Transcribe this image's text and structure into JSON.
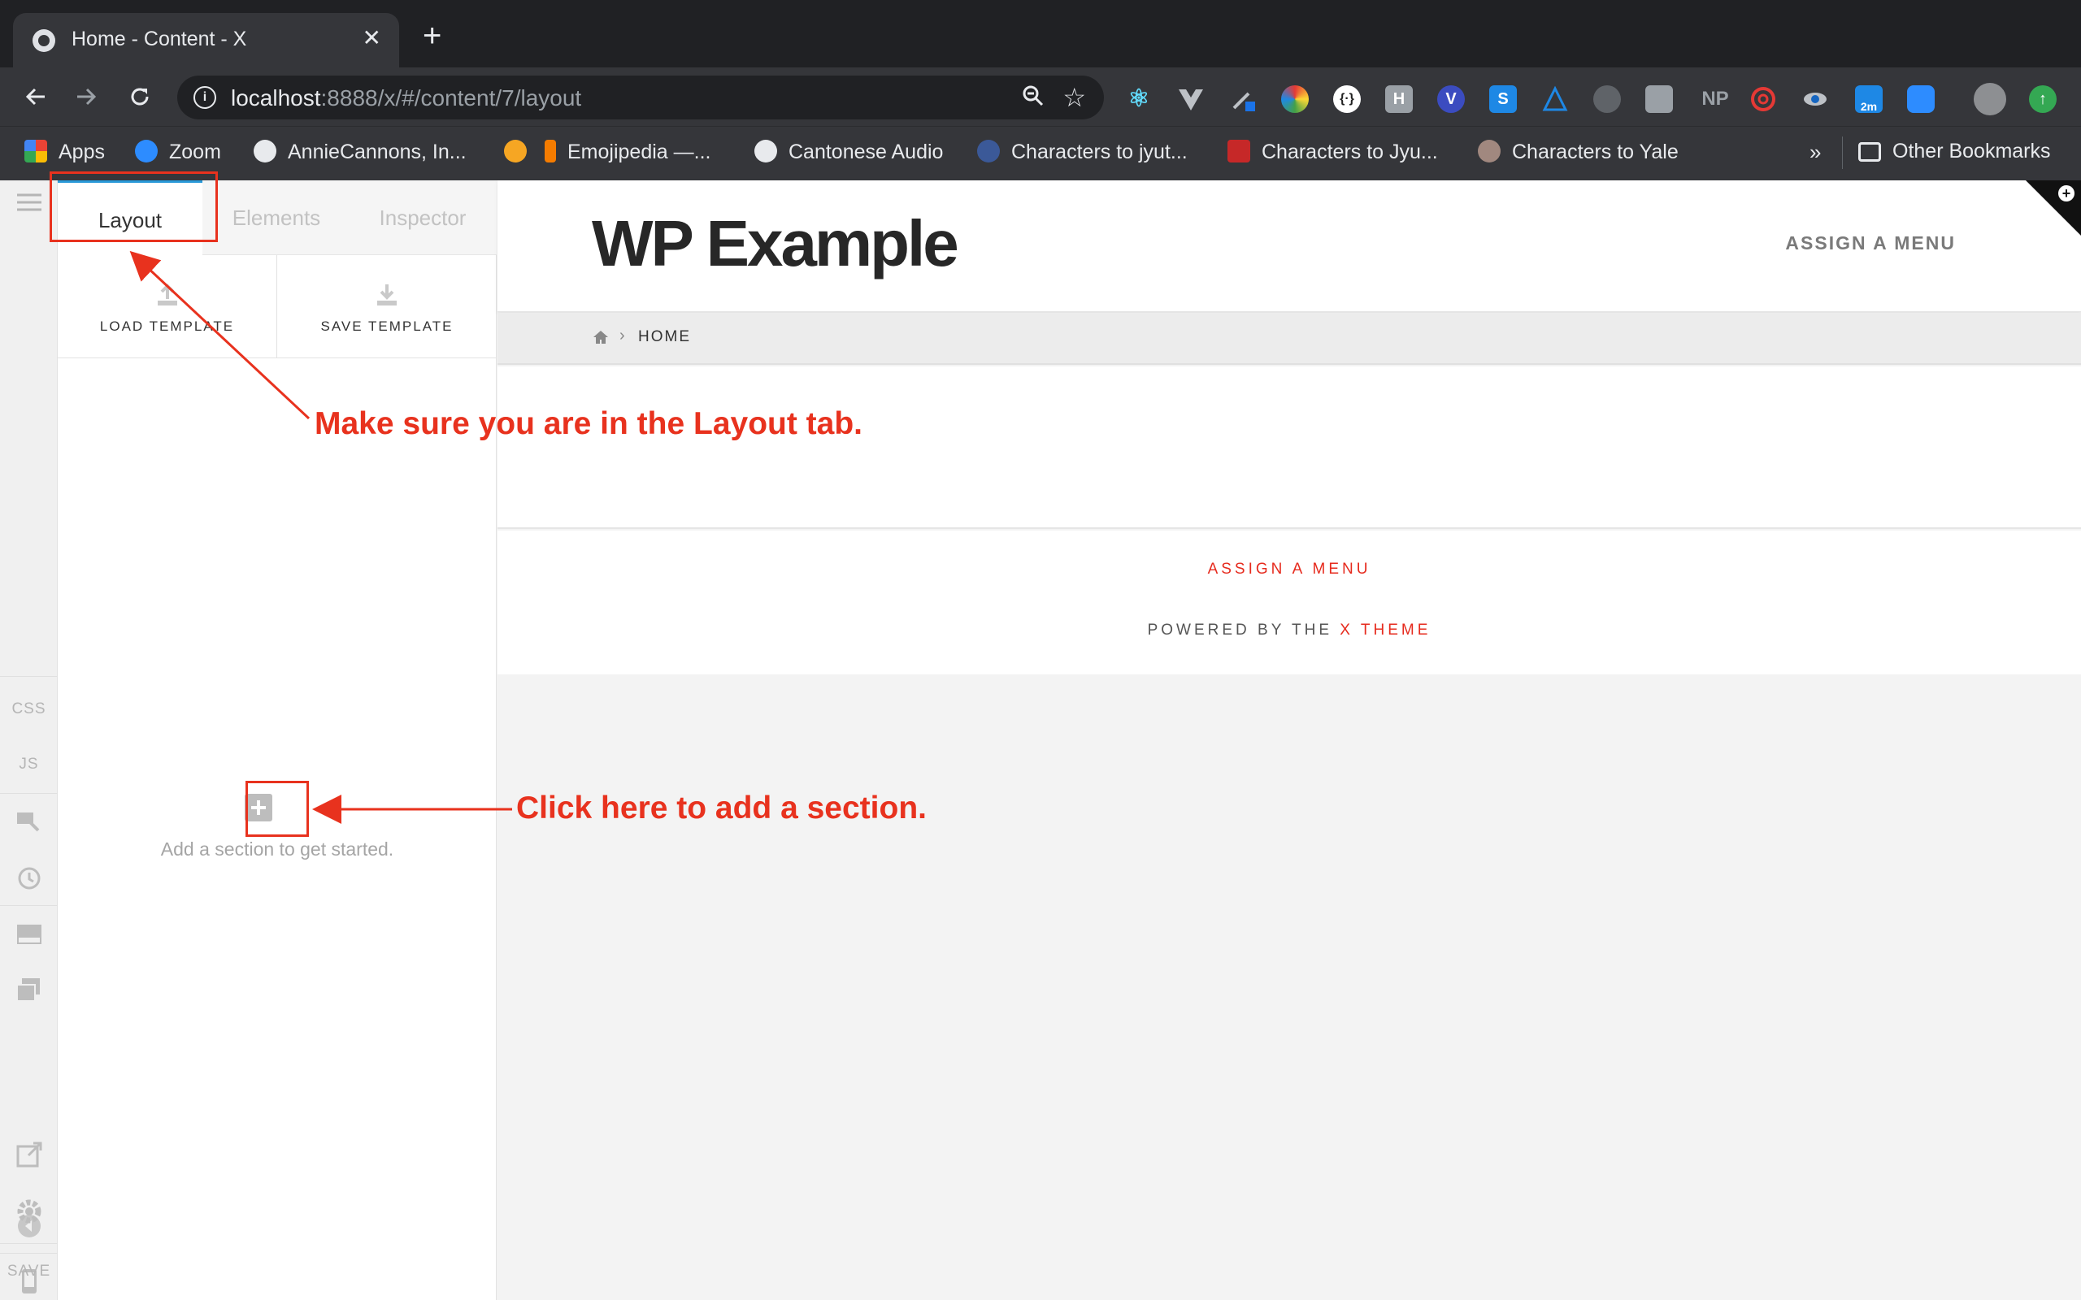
{
  "browser": {
    "tab_title": "Home - Content - X",
    "tab_close": "✕",
    "new_tab": "+",
    "url_host": "localhost",
    "url_rest": ":8888/x/#/content/7/layout",
    "extensions": [
      "react-icon",
      "vue-icon",
      "eyedropper-icon",
      "colorzilla-icon",
      "json-icon",
      "h-icon",
      "v-icon",
      "s-icon",
      "ruler-icon",
      "camera-icon",
      "puzzle-icon",
      "np-icon",
      "spiral-icon",
      "eye-icon",
      "timer-icon",
      "zoom-video-icon",
      "profile-avatar",
      "update-icon"
    ],
    "extension_labels": {
      "h": "H",
      "np": "NP",
      "s": "S",
      "v": "V",
      "timer": "2m"
    },
    "bookmarks": [
      {
        "label": "Apps",
        "icon": "apps-grid-icon"
      },
      {
        "label": "Zoom",
        "icon": "zoom-icon"
      },
      {
        "label": "AnnieCannons, In...",
        "icon": "github-icon"
      },
      {
        "label": "",
        "icon": "emoji-icon"
      },
      {
        "label": "Emojipedia —...",
        "icon": "bookmark-icon"
      },
      {
        "label": "Cantonese Audio",
        "icon": "globe-icon"
      },
      {
        "label": "Characters to jyut...",
        "icon": "puzzle-blue-icon"
      },
      {
        "label": "Characters to Jyu...",
        "icon": "chinese-char-icon"
      },
      {
        "label": "Characters to Yale",
        "icon": "figure-icon"
      }
    ],
    "bookmarks_overflow": "»",
    "other_bookmarks": "Other Bookmarks"
  },
  "builder": {
    "tabs": [
      "Layout",
      "Elements",
      "Inspector"
    ],
    "load_template": "LOAD TEMPLATE",
    "save_template": "SAVE TEMPLATE",
    "empty_message": "Add a section to get started.",
    "rail": {
      "css": "CSS",
      "js": "JS",
      "save": "SAVE"
    }
  },
  "site": {
    "title": "WP Example",
    "menu_top": "ASSIGN A MENU",
    "breadcrumb_current": "HOME",
    "footer_menu": "ASSIGN A MENU",
    "footer_powered": "POWERED BY THE",
    "footer_theme": "X THEME"
  },
  "annotations": {
    "layout_tab_note": "Make sure you are in the Layout tab.",
    "add_section_note": "Click here to add a section."
  },
  "colors": {
    "annotation": "#e8321e",
    "accent_tab": "#2a99d8",
    "footer_link": "#e62b1e"
  }
}
